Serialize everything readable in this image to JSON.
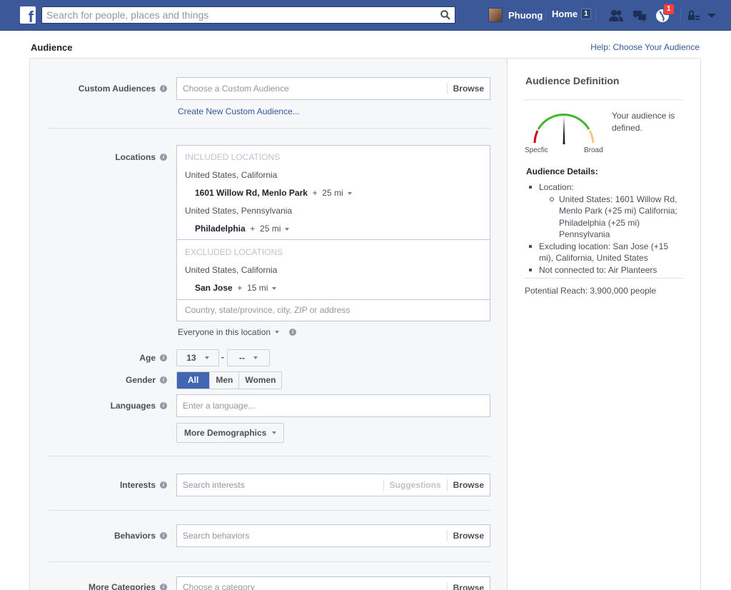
{
  "topbar": {
    "logo": "f",
    "search_placeholder": "Search for people, places and things",
    "user_name": "Phuong",
    "home_label": "Home",
    "home_count": "1",
    "notifications_count": "1"
  },
  "page": {
    "title": "Audience",
    "help_link": "Help: Choose Your Audience"
  },
  "custom_audiences": {
    "label": "Custom Audiences",
    "placeholder": "Choose a Custom Audience",
    "browse": "Browse",
    "create_link": "Create New Custom Audience..."
  },
  "locations": {
    "label": "Locations",
    "included_header": "INCLUDED LOCATIONS",
    "included": [
      {
        "region": "United States, California",
        "place": "1601 Willow Rd, Menlo Park",
        "radius": "25 mi"
      },
      {
        "region": "United States, Pennsylvania",
        "place": "Philadelphia",
        "radius": "25 mi"
      }
    ],
    "excluded_header": "EXCLUDED LOCATIONS",
    "excluded": [
      {
        "region": "United States, California",
        "place": "San Jose",
        "radius": "15 mi"
      }
    ],
    "plus": "+",
    "input_placeholder": "Country, state/province, city, ZIP or address",
    "scope": "Everyone in this location"
  },
  "age": {
    "label": "Age",
    "min": "13",
    "dash": "-",
    "max": "--"
  },
  "gender": {
    "label": "Gender",
    "options": [
      "All",
      "Men",
      "Women"
    ],
    "selected": "All"
  },
  "languages": {
    "label": "Languages",
    "placeholder": "Enter a language..."
  },
  "more_demographics": "More Demographics",
  "interests": {
    "label": "Interests",
    "placeholder": "Search interests",
    "suggestions": "Suggestions",
    "browse": "Browse"
  },
  "behaviors": {
    "label": "Behaviors",
    "placeholder": "Search behaviors",
    "browse": "Browse"
  },
  "more_categories": {
    "label": "More Categories",
    "placeholder": "Choose a category",
    "browse": "Browse"
  },
  "audience_definition": {
    "title": "Audience Definition",
    "status": "Your audience is defined.",
    "specific": "Specfic",
    "broad": "Broad",
    "details_title": "Audience Details:",
    "location_label": "Location:",
    "location_detail": "United States: 1601 Willow Rd, Menlo Park (+25 mi) California; Philadelphia (+25 mi) Pennsylvania",
    "excluding": "Excluding location: San Jose (+15 mi), California, United States",
    "not_connected": "Not connected to: Air Planteers",
    "potential_reach": "Potential Reach: 3,900,000 people"
  },
  "colors": {
    "brand": "#3b5998",
    "link": "#365899",
    "active": "#4267b2",
    "gauge_green": "#42b72a",
    "gauge_red": "#d0021b",
    "gauge_yellow": "#f7c87a"
  }
}
